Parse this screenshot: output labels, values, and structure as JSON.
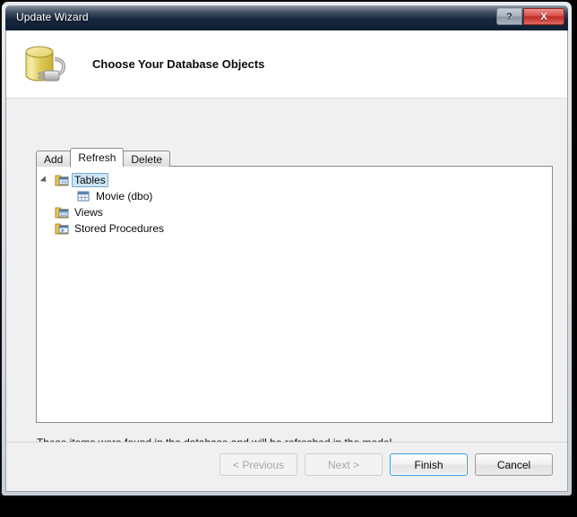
{
  "window": {
    "title": "Update Wizard",
    "caption_buttons": [
      {
        "name": "help-button",
        "label": "?"
      },
      {
        "name": "close-button",
        "label": "X"
      }
    ]
  },
  "header": {
    "icon": "database-plug-icon",
    "title": "Choose Your Database Objects"
  },
  "tabs": [
    {
      "label": "Add",
      "selected": false
    },
    {
      "label": "Refresh",
      "selected": true
    },
    {
      "label": "Delete",
      "selected": false
    }
  ],
  "tree": {
    "nodes": [
      {
        "label": "Tables",
        "icon": "tables-folder-icon",
        "level": 0,
        "expanded": true,
        "selected": true
      },
      {
        "label": "Movie (dbo)",
        "icon": "table-grid-icon",
        "level": 1,
        "expanded": false,
        "selected": false
      },
      {
        "label": "Views",
        "icon": "views-folder-icon",
        "level": 0,
        "expanded": false,
        "selected": false
      },
      {
        "label": "Stored Procedures",
        "icon": "stored-procedures-folder-icon",
        "level": 0,
        "expanded": false,
        "selected": false
      }
    ]
  },
  "status": {
    "message": "These items were found in the database and will be refreshed in the model."
  },
  "footer": {
    "buttons": [
      {
        "label": "< Previous",
        "state": "disabled"
      },
      {
        "label": "Next >",
        "state": "disabled"
      },
      {
        "label": "Finish",
        "state": "default"
      },
      {
        "label": "Cancel",
        "state": "normal"
      }
    ]
  },
  "colors": {
    "title_bar": "#16263c",
    "close_button": "#d9514a",
    "selection": "#cde6f7",
    "default_button_border": "#3d9ad4",
    "folder_yellow": "#f0c33c"
  }
}
